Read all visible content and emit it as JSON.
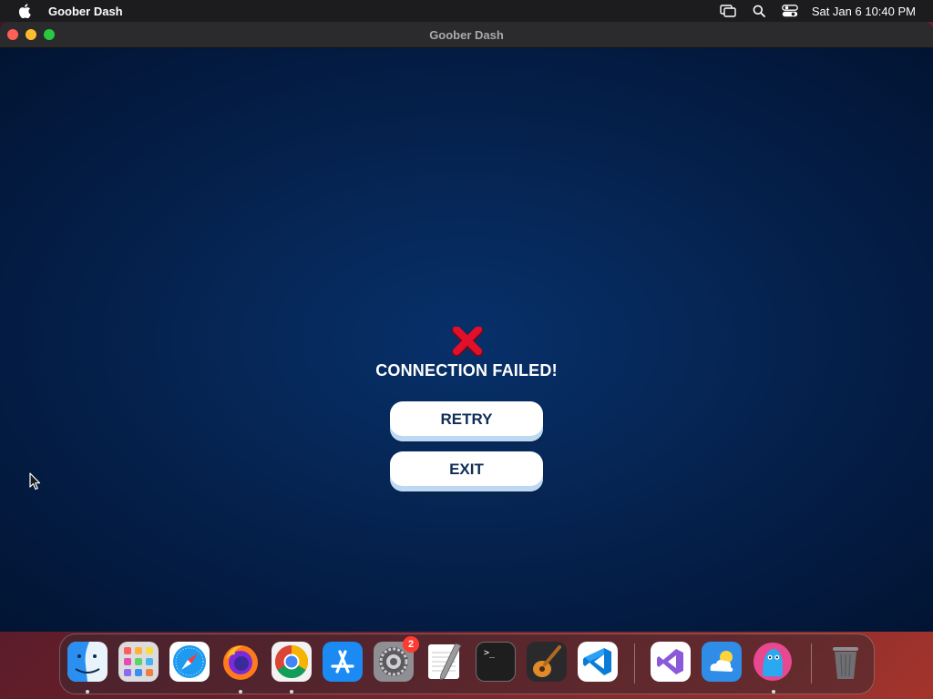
{
  "menubar": {
    "app_name": "Goober Dash",
    "clock": "Sat Jan 6  10:40 PM",
    "icons": [
      "apple-icon",
      "screen-mirroring-icon",
      "search-icon",
      "control-center-icon"
    ]
  },
  "window": {
    "title": "Goober Dash"
  },
  "game": {
    "error_icon": "red-x-icon",
    "message": "CONNECTION FAILED!",
    "retry_label": "RETRY",
    "exit_label": "EXIT"
  },
  "dock": {
    "apps": [
      {
        "name": "finder-icon",
        "running": true
      },
      {
        "name": "launchpad-icon",
        "running": false
      },
      {
        "name": "safari-icon",
        "running": false
      },
      {
        "name": "firefox-icon",
        "running": true
      },
      {
        "name": "chrome-icon",
        "running": true
      },
      {
        "name": "app-store-icon",
        "running": false
      },
      {
        "name": "system-settings-icon",
        "running": false,
        "badge": "2"
      },
      {
        "name": "textedit-icon",
        "running": false
      },
      {
        "name": "terminal-icon",
        "running": false
      },
      {
        "name": "garageband-icon",
        "running": false
      },
      {
        "name": "vscode-icon",
        "running": false
      },
      {
        "name": "visual-studio-icon",
        "running": false
      },
      {
        "name": "weather-icon",
        "running": false
      },
      {
        "name": "goober-dash-icon",
        "running": true
      },
      {
        "name": "trash-icon",
        "running": false
      }
    ],
    "terminal_prompt": ">_"
  },
  "colors": {
    "game_bg": "#062859",
    "button_text": "#0f2d55",
    "error_red": "#e0102b",
    "badge": "#ff3b30"
  }
}
